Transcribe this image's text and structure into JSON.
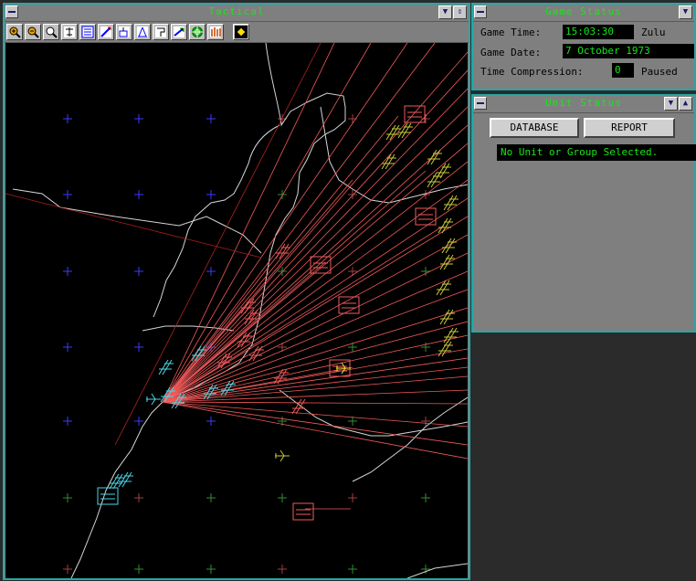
{
  "tactical": {
    "title": "Tactical",
    "toolbar_icons": [
      "zoom-in-icon",
      "zoom-out-icon",
      "zoom-find-icon",
      "airbase-icon",
      "formation-icon",
      "plot-course-icon",
      "radar-icon",
      "sensor-icon",
      "mission-icon",
      "air-strike-icon",
      "weapon-icon",
      "range-rings-icon",
      "center-map-icon"
    ]
  },
  "game_status": {
    "title": "Game Status",
    "game_time_label": "Game Time:",
    "game_time_value": "15:03:30",
    "game_time_zone": "Zulu",
    "game_date_label": "Game Date:",
    "game_date_value": "7 October 1973",
    "compression_label": "Time Compression:",
    "compression_value": "0",
    "paused_label": "Paused"
  },
  "unit_status": {
    "title": "Unit Status",
    "database_label": "DATABASE",
    "report_label": "REPORT",
    "message": "No Unit or Group Selected."
  },
  "colors": {
    "window_border": "#25a7a7",
    "title_text": "#19e619",
    "map_bg": "#000000",
    "coast": "#d6d6d6",
    "friendly": "#4ad7e6",
    "enemy": "#f25a5a",
    "unknown": "#c8c83a",
    "grid_blue": "#3a3aff",
    "grid_green": "#2f8f2f",
    "grid_red": "#a04040"
  }
}
